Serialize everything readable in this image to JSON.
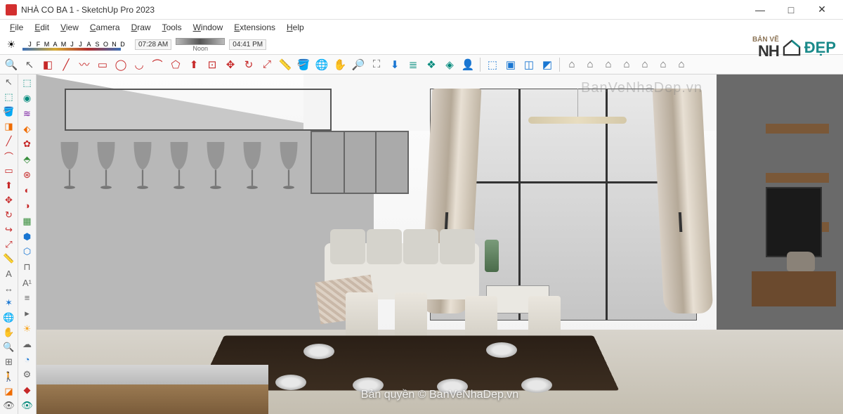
{
  "window": {
    "title": "NHÀ CO BA 1 - SketchUp Pro 2023",
    "minimize": "—",
    "maximize": "□",
    "close": "✕"
  },
  "menu": {
    "items": [
      "File",
      "Edit",
      "View",
      "Camera",
      "Draw",
      "Tools",
      "Window",
      "Extensions",
      "Help"
    ]
  },
  "shadow_bar": {
    "months": [
      "J",
      "F",
      "M",
      "A",
      "M",
      "J",
      "J",
      "A",
      "S",
      "O",
      "N",
      "D"
    ],
    "time_start": "07:28 AM",
    "noon_label": "Noon",
    "time_end": "04:41 PM"
  },
  "watermark": {
    "top": "BanVeNhaDep.vn",
    "bottom": "Bản quyền © BanVeNhaDep.vn"
  },
  "brand": {
    "prefix": "BẢN VẼ",
    "main": "NH",
    "suffix": "ĐẸP"
  },
  "large_tools": [
    {
      "name": "search-icon",
      "glyph": "🔍",
      "cls": "ic-gray"
    },
    {
      "name": "select-icon",
      "glyph": "↖",
      "cls": "ic-gray"
    },
    {
      "name": "eraser-icon",
      "glyph": "◧",
      "cls": "ic-red"
    },
    {
      "name": "line-icon",
      "glyph": "╱",
      "cls": "ic-red"
    },
    {
      "name": "freehand-icon",
      "glyph": "〰",
      "cls": "ic-red"
    },
    {
      "name": "rect-icon",
      "glyph": "▭",
      "cls": "ic-red"
    },
    {
      "name": "circle-icon",
      "glyph": "◯",
      "cls": "ic-red"
    },
    {
      "name": "arc-icon",
      "glyph": "◡",
      "cls": "ic-red"
    },
    {
      "name": "arc2-icon",
      "glyph": "⌒",
      "cls": "ic-red"
    },
    {
      "name": "polygon-icon",
      "glyph": "⬠",
      "cls": "ic-red"
    },
    {
      "name": "pushpull-icon",
      "glyph": "⬆",
      "cls": "ic-red"
    },
    {
      "name": "offset-icon",
      "glyph": "⊡",
      "cls": "ic-red"
    },
    {
      "name": "move-icon",
      "glyph": "✥",
      "cls": "ic-red"
    },
    {
      "name": "rotate-icon",
      "glyph": "↻",
      "cls": "ic-red"
    },
    {
      "name": "scale-icon",
      "glyph": "⤢",
      "cls": "ic-red"
    },
    {
      "name": "tape-icon",
      "glyph": "📏",
      "cls": "ic-yellow"
    },
    {
      "name": "paint-icon",
      "glyph": "🪣",
      "cls": "ic-orange"
    },
    {
      "name": "orbit-icon",
      "glyph": "🌐",
      "cls": "ic-green"
    },
    {
      "name": "pan-icon",
      "glyph": "✋",
      "cls": "ic-orange"
    },
    {
      "name": "zoom-icon",
      "glyph": "🔎",
      "cls": "ic-gray"
    },
    {
      "name": "zoom-ext-icon",
      "glyph": "⛶",
      "cls": "ic-gray"
    },
    {
      "name": "warehouse-icon",
      "glyph": "⬇",
      "cls": "ic-blue"
    },
    {
      "name": "layers-icon",
      "glyph": "≣",
      "cls": "ic-teal"
    },
    {
      "name": "layers2-icon",
      "glyph": "❖",
      "cls": "ic-teal"
    },
    {
      "name": "layers3-icon",
      "glyph": "◈",
      "cls": "ic-teal"
    },
    {
      "name": "person-icon",
      "glyph": "👤",
      "cls": "ic-gray"
    },
    {
      "name": "sep",
      "glyph": "",
      "cls": ""
    },
    {
      "name": "view-iso-icon",
      "glyph": "⬚",
      "cls": "ic-blue"
    },
    {
      "name": "view-top-icon",
      "glyph": "▣",
      "cls": "ic-blue"
    },
    {
      "name": "view-front-icon",
      "glyph": "◫",
      "cls": "ic-blue"
    },
    {
      "name": "view-back-icon",
      "glyph": "◩",
      "cls": "ic-blue"
    },
    {
      "name": "sep",
      "glyph": "",
      "cls": ""
    },
    {
      "name": "style1-icon",
      "glyph": "⌂",
      "cls": "ic-gray"
    },
    {
      "name": "style2-icon",
      "glyph": "⌂",
      "cls": "ic-gray"
    },
    {
      "name": "style3-icon",
      "glyph": "⌂",
      "cls": "ic-gray"
    },
    {
      "name": "style4-icon",
      "glyph": "⌂",
      "cls": "ic-gray"
    },
    {
      "name": "style5-icon",
      "glyph": "⌂",
      "cls": "ic-gray"
    },
    {
      "name": "style6-icon",
      "glyph": "⌂",
      "cls": "ic-gray"
    },
    {
      "name": "style7-icon",
      "glyph": "⌂",
      "cls": "ic-gray"
    }
  ],
  "left_toolbar": [
    {
      "name": "select-tool-icon",
      "glyph": "↖",
      "cls": "ic-gray"
    },
    {
      "name": "component-icon",
      "glyph": "⬚",
      "cls": "ic-teal"
    },
    {
      "name": "paint-bucket-icon",
      "glyph": "🪣",
      "cls": "ic-orange"
    },
    {
      "name": "eraser2-icon",
      "glyph": "◨",
      "cls": "ic-orange"
    },
    {
      "name": "line2-icon",
      "glyph": "╱",
      "cls": "ic-red"
    },
    {
      "name": "arc3-icon",
      "glyph": "⌒",
      "cls": "ic-red"
    },
    {
      "name": "shape-icon",
      "glyph": "▭",
      "cls": "ic-red"
    },
    {
      "name": "push2-icon",
      "glyph": "⬆",
      "cls": "ic-red"
    },
    {
      "name": "move2-icon",
      "glyph": "✥",
      "cls": "ic-red"
    },
    {
      "name": "rotate2-icon",
      "glyph": "↻",
      "cls": "ic-red"
    },
    {
      "name": "followme-icon",
      "glyph": "↪",
      "cls": "ic-red"
    },
    {
      "name": "scale2-icon",
      "glyph": "⤢",
      "cls": "ic-red"
    },
    {
      "name": "tape2-icon",
      "glyph": "📏",
      "cls": "ic-yellow"
    },
    {
      "name": "text-icon",
      "glyph": "A",
      "cls": "ic-gray"
    },
    {
      "name": "dim-icon",
      "glyph": "↔",
      "cls": "ic-gray"
    },
    {
      "name": "axes-icon",
      "glyph": "✶",
      "cls": "ic-blue"
    },
    {
      "name": "orbit2-icon",
      "glyph": "🌐",
      "cls": "ic-green"
    },
    {
      "name": "pan2-icon",
      "glyph": "✋",
      "cls": "ic-orange"
    },
    {
      "name": "zoom2-icon",
      "glyph": "🔍",
      "cls": "ic-gray"
    },
    {
      "name": "zoomwin-icon",
      "glyph": "⊞",
      "cls": "ic-gray"
    },
    {
      "name": "walk-icon",
      "glyph": "🚶",
      "cls": "ic-gray"
    },
    {
      "name": "section-icon",
      "glyph": "◪",
      "cls": "ic-orange"
    },
    {
      "name": "look-icon",
      "glyph": "👁",
      "cls": "ic-gray"
    }
  ],
  "left_toolbar2": [
    {
      "name": "make-comp-icon",
      "glyph": "⬚",
      "cls": "ic-teal"
    },
    {
      "name": "material-icon",
      "glyph": "◉",
      "cls": "ic-teal"
    },
    {
      "name": "curviloft-icon",
      "glyph": "≋",
      "cls": "ic-purple"
    },
    {
      "name": "fredo1-icon",
      "glyph": "⬖",
      "cls": "ic-orange"
    },
    {
      "name": "fredo2-icon",
      "glyph": "✿",
      "cls": "ic-red"
    },
    {
      "name": "fredo3-icon",
      "glyph": "⬘",
      "cls": "ic-green"
    },
    {
      "name": "joint-icon",
      "glyph": "⊛",
      "cls": "ic-red"
    },
    {
      "name": "round-icon",
      "glyph": "◐",
      "cls": "ic-red"
    },
    {
      "name": "bevel-icon",
      "glyph": "◑",
      "cls": "ic-red"
    },
    {
      "name": "sandbox-icon",
      "glyph": "▦",
      "cls": "ic-green"
    },
    {
      "name": "solid1-icon",
      "glyph": "⬢",
      "cls": "ic-blue"
    },
    {
      "name": "solid2-icon",
      "glyph": "⬡",
      "cls": "ic-blue"
    },
    {
      "name": "profile-icon",
      "glyph": "⊓",
      "cls": "ic-gray"
    },
    {
      "name": "label-icon",
      "glyph": "A¹",
      "cls": "ic-gray"
    },
    {
      "name": "outliner-icon",
      "glyph": "≡",
      "cls": "ic-gray"
    },
    {
      "name": "scene-icon",
      "glyph": "▸",
      "cls": "ic-gray"
    },
    {
      "name": "shadow-icon",
      "glyph": "☀",
      "cls": "ic-yellow"
    },
    {
      "name": "fog-icon",
      "glyph": "☁",
      "cls": "ic-gray"
    },
    {
      "name": "soften-icon",
      "glyph": "◔",
      "cls": "ic-blue"
    },
    {
      "name": "ext1-icon",
      "glyph": "⚙",
      "cls": "ic-gray"
    },
    {
      "name": "ext2-icon",
      "glyph": "◆",
      "cls": "ic-red"
    },
    {
      "name": "ext3-icon",
      "glyph": "👁",
      "cls": "ic-teal"
    }
  ]
}
